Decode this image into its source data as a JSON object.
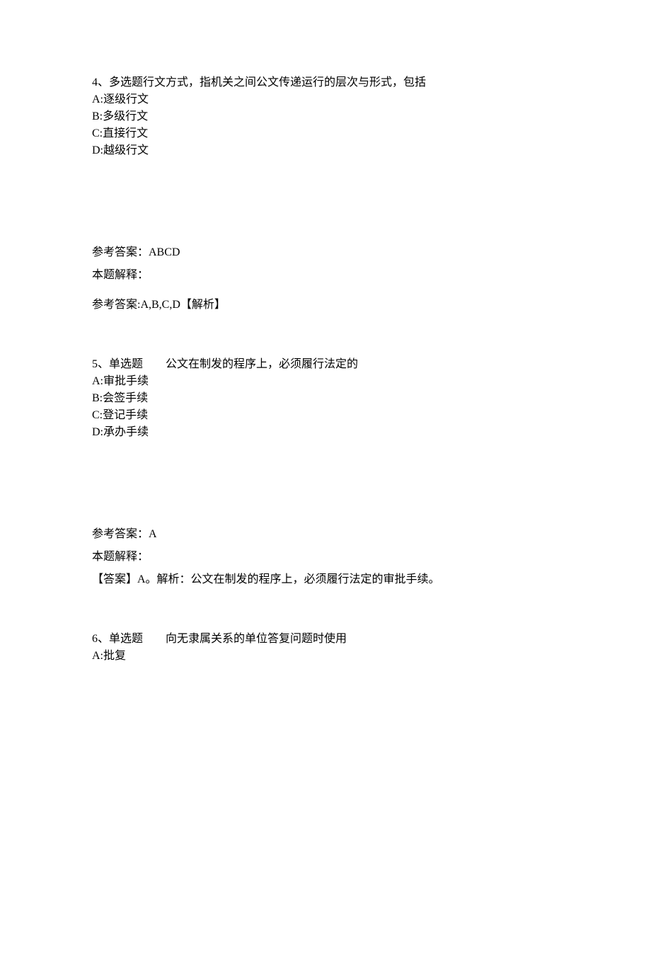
{
  "q4": {
    "header": "4、多选题行文方式，指机关之间公文传递运行的层次与形式，包括",
    "options": {
      "a": "A:逐级行文",
      "b": "B:多级行文",
      "c": "C:直接行文",
      "d": "D:越级行文"
    },
    "answer_label": "参考答案：ABCD",
    "explain_label": "本题解释：",
    "explain_text": "参考答案:A,B,C,D【解析】"
  },
  "q5": {
    "header": "5、单选题　　公文在制发的程序上，必须履行法定的",
    "options": {
      "a": "A:审批手续",
      "b": "B:会签手续",
      "c": "C:登记手续",
      "d": "D:承办手续"
    },
    "answer_label": "参考答案：A",
    "explain_label": "本题解释：",
    "explain_text": "【答案】A。解析：公文在制发的程序上，必须履行法定的审批手续。"
  },
  "q6": {
    "header": "6、单选题　　向无隶属关系的单位答复问题时使用",
    "options": {
      "a": "A:批复"
    }
  }
}
